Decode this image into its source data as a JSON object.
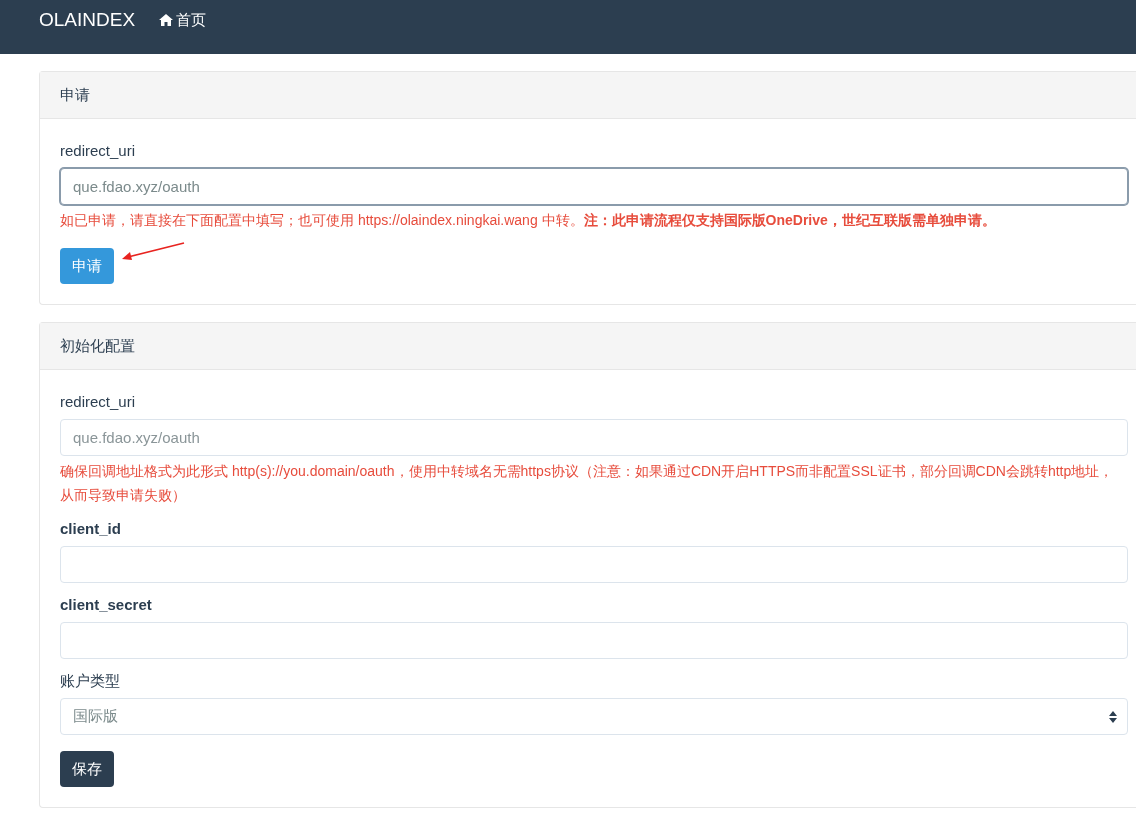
{
  "navbar": {
    "brand": "OLAINDEX",
    "items": [
      {
        "label": "首页"
      }
    ]
  },
  "panels": [
    {
      "title": "申请",
      "fields": [
        {
          "kind": "text",
          "label": "redirect_uri",
          "strong": false,
          "value": "que.fdao.xyz/oauth",
          "focused": true,
          "help": "如已申请，请直接在下面配置中填写；也可使用 https://olaindex.ningkai.wang 中转。**注：此申请流程仅支持国际版OneDrive，世纪互联版需单独申请。**"
        }
      ],
      "button": {
        "label": "申请",
        "kind": "primary",
        "annotated": true
      }
    },
    {
      "title": "初始化配置",
      "fields": [
        {
          "kind": "text",
          "label": "redirect_uri",
          "strong": false,
          "placeholder": "que.fdao.xyz/oauth",
          "focused": false,
          "help": "确保回调地址格式为此形式 http(s)://you.domain/oauth，使用中转域名无需https协议（注意：如果通过CDN开启HTTPS而非配置SSL证书，部分回调CDN会跳转http地址，从而导致申请失败）"
        },
        {
          "kind": "text",
          "label": "client_id",
          "strong": true,
          "focused": false
        },
        {
          "kind": "text",
          "label": "client_secret",
          "strong": true,
          "focused": false
        },
        {
          "kind": "select",
          "label": "账户类型",
          "strong": false,
          "value": "国际版",
          "focused": false
        }
      ],
      "button": {
        "label": "保存",
        "kind": "dark"
      }
    }
  ]
}
